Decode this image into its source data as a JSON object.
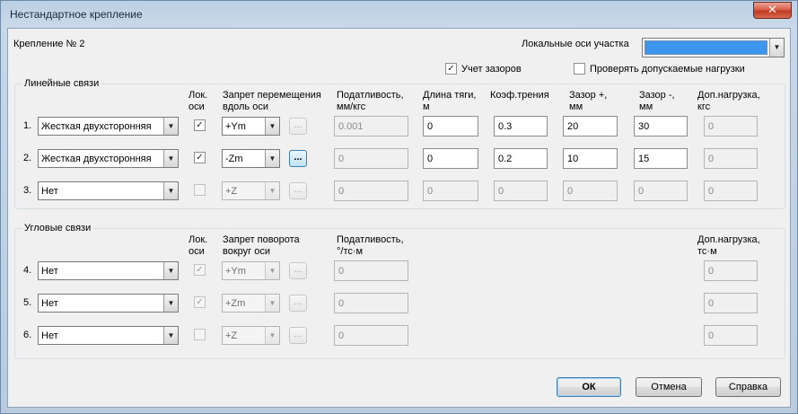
{
  "window": {
    "title": "Нестандартное крепление",
    "close_glyph": "✕"
  },
  "header": {
    "fastening_label": "Крепление № 2",
    "local_axes_label": "Локальные оси участка",
    "local_axes_color": "#3d95ed",
    "gaps_label": "Учет зазоров",
    "gaps_checked": true,
    "check_loads_label": "Проверять допускаемые нагрузки",
    "check_loads_checked": false
  },
  "linear": {
    "title": "Линейные связи",
    "headers": {
      "loc1": "Лок.",
      "loc2": "оси",
      "ban1": "Запрет перемещения",
      "ban2": "вдоль оси",
      "comp1": "Податливость,",
      "comp2": "мм/кгс",
      "rod1": "Длина тяги,",
      "rod2": "м",
      "fric": "Коэф.трения",
      "gp1": "Зазор +,",
      "gp2": "мм",
      "gm1": "Зазор -,",
      "gm2": "мм",
      "ld1": "Доп.нагрузка,",
      "ld2": "кгс"
    },
    "rows": [
      {
        "num": "1.",
        "type": "Жесткая двухсторонняя",
        "local": "✓",
        "axis": "+Ym",
        "ell": "...",
        "compliance": "0.001",
        "rod": "0",
        "friction": "0.3",
        "gap_plus": "20",
        "gap_minus": "30",
        "load": "0"
      },
      {
        "num": "2.",
        "type": "Жесткая двухсторонняя",
        "local": "✓",
        "axis": "-Zm",
        "ell": "...",
        "compliance": "0",
        "rod": "0",
        "friction": "0.2",
        "gap_plus": "10",
        "gap_minus": "15",
        "load": "0"
      },
      {
        "num": "3.",
        "type": "Нет",
        "local": "",
        "axis": "+Z",
        "ell": "...",
        "compliance": "0",
        "rod": "0",
        "friction": "0",
        "gap_plus": "0",
        "gap_minus": "0",
        "load": "0"
      }
    ]
  },
  "angular": {
    "title": "Угловые связи",
    "headers": {
      "loc1": "Лок.",
      "loc2": "оси",
      "ban1": "Запрет поворота",
      "ban2": "вокруг оси",
      "comp1": "Податливость,",
      "comp2": "°/тс·м",
      "ld1": "Доп.нагрузка,",
      "ld2": "тс·м"
    },
    "rows": [
      {
        "num": "4.",
        "type": "Нет",
        "local": "✓",
        "axis": "+Ym",
        "ell": "...",
        "compliance": "0",
        "load": "0"
      },
      {
        "num": "5.",
        "type": "Нет",
        "local": "✓",
        "axis": "+Zm",
        "ell": "...",
        "compliance": "0",
        "load": "0"
      },
      {
        "num": "6.",
        "type": "Нет",
        "local": "",
        "axis": "+Z",
        "ell": "...",
        "compliance": "0",
        "load": "0"
      }
    ]
  },
  "buttons": {
    "ok": "ОК",
    "cancel": "Отмена",
    "help": "Справка"
  },
  "icons": {
    "dropdown": "chevron-down-icon",
    "check": "check-icon",
    "close": "close-icon"
  }
}
